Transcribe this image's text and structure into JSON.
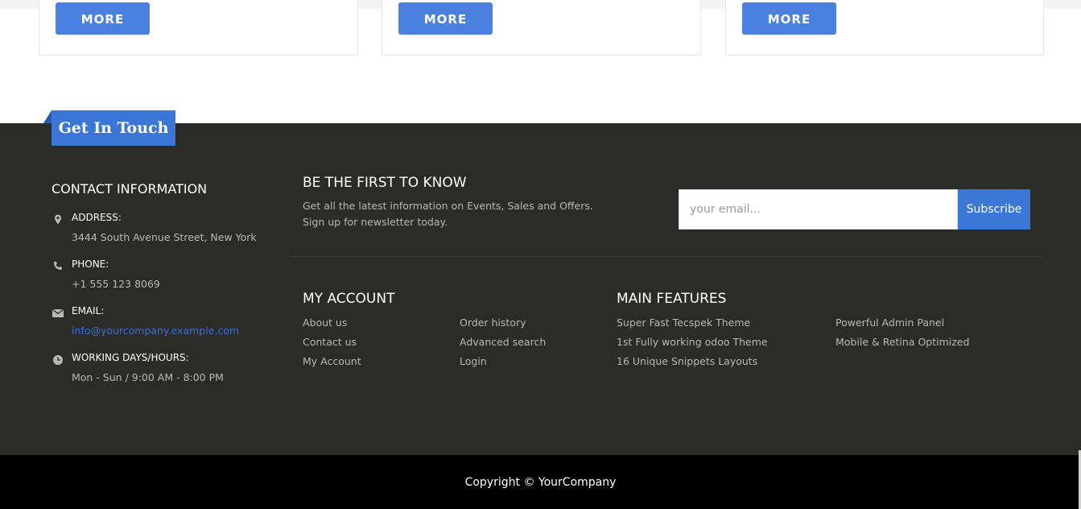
{
  "cards": [
    {
      "more_label": "MORE"
    },
    {
      "more_label": "MORE"
    },
    {
      "more_label": "MORE"
    }
  ],
  "footer": {
    "tab_title": "Get In Touch",
    "contact": {
      "title": "CONTACT INFORMATION",
      "items": [
        {
          "icon": "map-pin-icon",
          "label": "ADDRESS:",
          "value": "3444 South Avenue Street, New York"
        },
        {
          "icon": "phone-icon",
          "label": "PHONE:",
          "value": "+1 555 123 8069"
        },
        {
          "icon": "envelope-icon",
          "label": "EMAIL:",
          "value": "info@yourcompany.example.com"
        },
        {
          "icon": "clock-icon",
          "label": "WORKING DAYS/HOURS:",
          "value": "Mon - Sun / 9:00 AM - 8:00 PM"
        }
      ]
    },
    "newsletter": {
      "title": "BE THE FIRST TO KNOW",
      "desc_line1": "Get all the latest information on Events, Sales and Offers.",
      "desc_line2": "Sign up for newsletter today.",
      "email_placeholder": "your email...",
      "subscribe_label": "Subscribe"
    },
    "my_account": {
      "title": "MY ACCOUNT",
      "col1": [
        "About us",
        "Contact us",
        "My Account"
      ],
      "col2": [
        "Order history",
        "Advanced search",
        "Login"
      ]
    },
    "main_features": {
      "title": "MAIN FEATURES",
      "col1": [
        "Super Fast Tecspek Theme",
        "1st Fully working odoo Theme",
        "16 Unique Snippets Layouts"
      ],
      "col2": [
        "Powerful Admin Panel",
        "Mobile & Retina Optimized"
      ]
    },
    "copyright": "Copyright © YourCompany"
  },
  "colors": {
    "accent": "#3a76d6",
    "footer_bg": "#2b2b28",
    "copyright_bg": "#000000"
  }
}
